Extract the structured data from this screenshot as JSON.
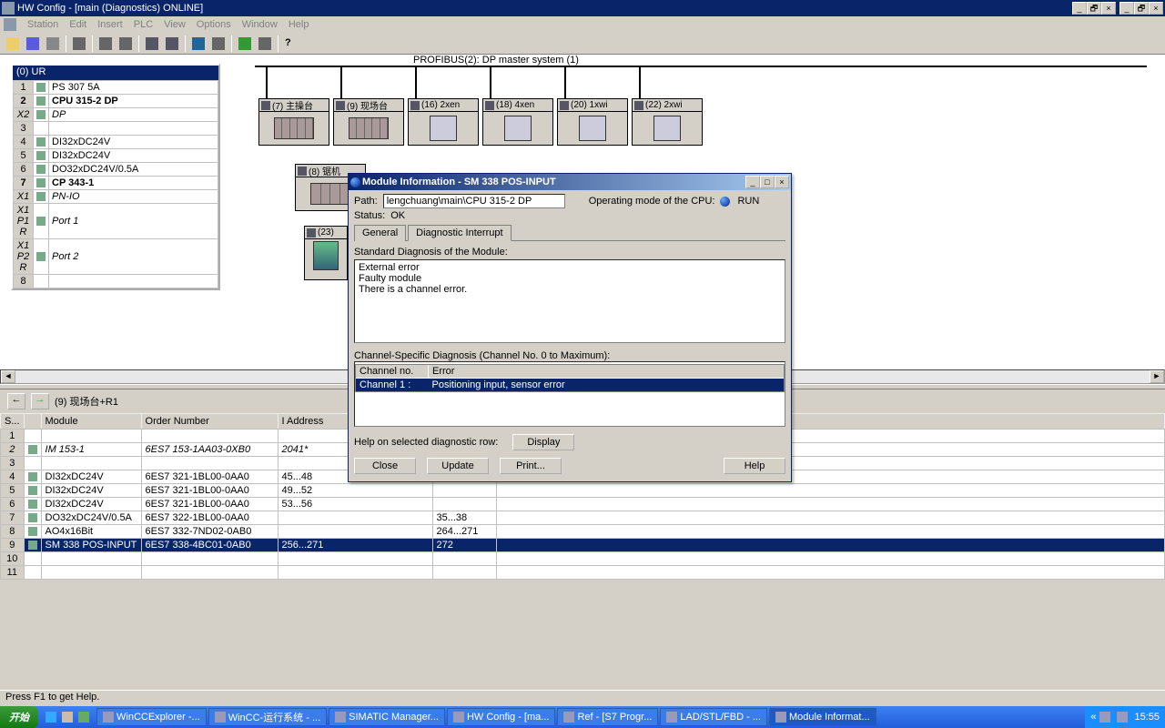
{
  "window": {
    "title": "HW Config - [main (Diagnostics)  ONLINE]",
    "min": "_",
    "max": "□",
    "restore": "🗗",
    "close": "×"
  },
  "menu": {
    "station": "Station",
    "edit": "Edit",
    "insert": "Insert",
    "plc": "PLC",
    "view": "View",
    "options": "Options",
    "window": "Window",
    "help": "Help"
  },
  "rack": {
    "header": "(0) UR",
    "rows": [
      {
        "slot": "1",
        "name": "PS 307 5A"
      },
      {
        "slot": "2",
        "name": "CPU 315-2 DP",
        "bold": true
      },
      {
        "slot": "X2",
        "name": "DP",
        "italic": true
      },
      {
        "slot": "3",
        "name": ""
      },
      {
        "slot": "4",
        "name": "DI32xDC24V"
      },
      {
        "slot": "5",
        "name": "DI32xDC24V"
      },
      {
        "slot": "6",
        "name": "DO32xDC24V/0.5A"
      },
      {
        "slot": "7",
        "name": "CP 343-1",
        "bold": true
      },
      {
        "slot": "X1",
        "name": "PN-IO",
        "italic": true
      },
      {
        "slot": "X1 P1 R",
        "name": "Port 1",
        "italic": true
      },
      {
        "slot": "X1 P2 R",
        "name": "Port 2",
        "italic": true
      },
      {
        "slot": "8",
        "name": ""
      }
    ]
  },
  "bus": {
    "label": "PROFIBUS(2): DP master system (1)"
  },
  "stations": [
    {
      "label": "(7) 主操台"
    },
    {
      "label": "(9) 现场台"
    },
    {
      "label": "(16) 2xen"
    },
    {
      "label": "(18) 4xen"
    },
    {
      "label": "(20) 1xwi"
    },
    {
      "label": "(22) 2xwi"
    },
    {
      "label": "(8) 锯机"
    },
    {
      "label": "(23)"
    }
  ],
  "detail_header": {
    "nav_back": "←",
    "nav_fwd": "→",
    "text": "(9)    现场台+R1"
  },
  "detail_cols": {
    "slot": "S...",
    "icon": "",
    "module": "Module",
    "order": "Order Number",
    "iaddr": "I Address",
    "qaddr": "",
    "m1": "",
    "m2": ""
  },
  "detail_rows": [
    {
      "idx": "1"
    },
    {
      "idx": "2",
      "module": "IM 153-1",
      "order": "6ES7 153-1AA03-0XB0",
      "iaddr": "2041*",
      "italic": true
    },
    {
      "idx": "3"
    },
    {
      "idx": "4",
      "module": "DI32xDC24V",
      "order": "6ES7 321-1BL00-0AA0",
      "iaddr": "45...48"
    },
    {
      "idx": "5",
      "module": "DI32xDC24V",
      "order": "6ES7 321-1BL00-0AA0",
      "iaddr": "49...52"
    },
    {
      "idx": "6",
      "module": "DI32xDC24V",
      "order": "6ES7 321-1BL00-0AA0",
      "iaddr": "53...56"
    },
    {
      "idx": "7",
      "module": "DO32xDC24V/0.5A",
      "order": "6ES7 322-1BL00-0AA0",
      "qaddr": "35...38"
    },
    {
      "idx": "8",
      "module": "AO4x16Bit",
      "order": "6ES7 332-7ND02-0AB0",
      "qaddr": "264...271"
    },
    {
      "idx": "9",
      "module": "SM 338 POS-INPUT",
      "order": "6ES7 338-4BC01-0AB0",
      "iaddr": "256...271",
      "qaddr": "272",
      "sel": true
    },
    {
      "idx": "10"
    },
    {
      "idx": "11"
    }
  ],
  "dialog": {
    "title": "Module Information - SM 338 POS-INPUT",
    "path_label": "Path:",
    "path": "lengchuang\\main\\CPU 315-2 DP",
    "op_label": "Operating mode of the  CPU:",
    "op_mode": "RUN",
    "status_label": "Status:",
    "status": "OK",
    "tab_general": "General",
    "tab_diag": "Diagnostic Interrupt",
    "std_label": "Standard Diagnosis of the Module:",
    "std_lines": [
      "External error",
      "Faulty module",
      "There is a channel error."
    ],
    "chan_label": "Channel-Specific Diagnosis (Channel No. 0 to Maximum):",
    "chan_col1": "Channel no.",
    "chan_col2": "Error",
    "chan_rows": [
      {
        "no": "Channel  1 :",
        "err": "Positioning input, sensor error"
      }
    ],
    "help_row": "Help on selected diagnostic row:",
    "btn_display": "Display",
    "btn_close": "Close",
    "btn_update": "Update",
    "btn_print": "Print...",
    "btn_help": "Help"
  },
  "statusbar": {
    "text": "Press F1 to get Help."
  },
  "taskbar": {
    "start": "开始",
    "tasks": [
      "WinCCExplorer -...",
      "WinCC-运行系统 - ...",
      "SIMATIC Manager...",
      "HW Config - [ma...",
      "Ref - [S7 Progr...",
      "LAD/STL/FBD - ...",
      "Module Informat..."
    ],
    "tray_arrows": "«",
    "clock": "15:55"
  }
}
